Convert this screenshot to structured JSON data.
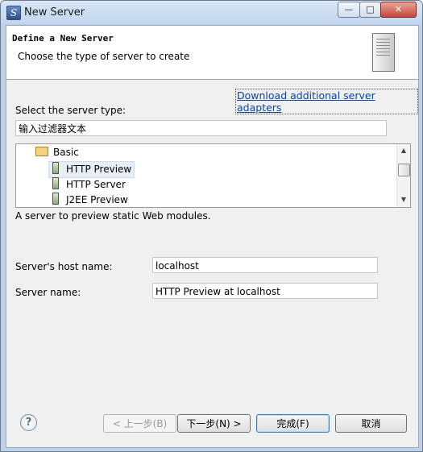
{
  "window": {
    "title": "New Server",
    "app_icon": "eclipse-s-icon"
  },
  "banner": {
    "title": "Define a New Server",
    "description": "Choose the type of server to create",
    "graphic": "server-tower-icon"
  },
  "download_link": "Download additional server adapters",
  "server_type": {
    "label": "Select the server type:",
    "filter_value": "输入过滤器文本"
  },
  "tree": {
    "folder": {
      "label": "Basic",
      "icon": "folder-open-icon"
    },
    "items": [
      {
        "label": "HTTP Preview",
        "selected": true
      },
      {
        "label": "HTTP Server",
        "selected": false
      },
      {
        "label": "J2EE Preview",
        "selected": false
      }
    ]
  },
  "description": "A server to preview static Web modules.",
  "host": {
    "label": "Server's host name:",
    "value": "localhost"
  },
  "server_name": {
    "label": "Server name:",
    "value": "HTTP Preview at localhost"
  },
  "buttons": {
    "help": "?",
    "back": "< 上一步(B)",
    "next": "下一步(N) >",
    "finish": "完成(F)",
    "cancel": "取消"
  }
}
